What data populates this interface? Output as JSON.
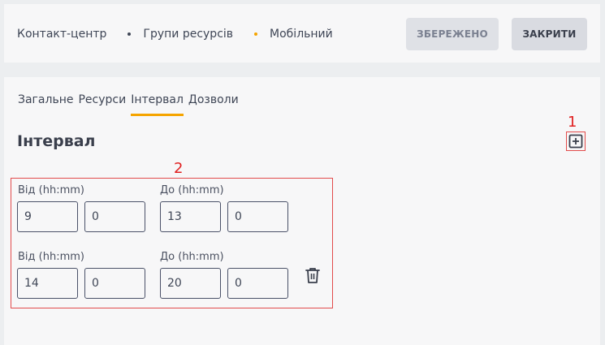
{
  "header": {
    "breadcrumb": [
      "Контакт-центр",
      "Групи ресурсів",
      "Мобільний"
    ],
    "dot_colors": [
      "#3f4656",
      "#f5a400"
    ],
    "saved_label": "ЗБЕРЕЖЕНО",
    "close_label": "ЗАКРИТИ"
  },
  "tabs": [
    {
      "label": "Загальне",
      "active": false
    },
    {
      "label": "Ресурси",
      "active": false
    },
    {
      "label": "Інтервал",
      "active": true
    },
    {
      "label": "Дозволи",
      "active": false
    }
  ],
  "section": {
    "title": "Інтервал",
    "add_icon": "plus-square-icon"
  },
  "annotations": [
    "1",
    "2"
  ],
  "intervals": [
    {
      "from_label": "Від (hh:mm)",
      "to_label": "До (hh:mm)",
      "from_h": "9",
      "from_m": "0",
      "to_h": "13",
      "to_m": "0",
      "deletable": false
    },
    {
      "from_label": "Від (hh:mm)",
      "to_label": "До (hh:mm)",
      "from_h": "14",
      "from_m": "0",
      "to_h": "20",
      "to_m": "0",
      "deletable": true
    }
  ],
  "colors": {
    "accent": "#f5a400",
    "annotation": "#e02020"
  }
}
